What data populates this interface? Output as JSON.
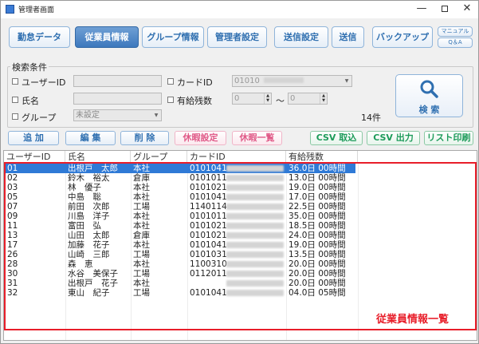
{
  "window": {
    "title": "管理者画面",
    "minimize": "—",
    "close": "✕"
  },
  "tabs": [
    "勤怠データ",
    "従業員情報",
    "グループ情報",
    "管理者設定",
    "送信設定",
    "送信",
    "バックアップ"
  ],
  "help_links": [
    "マニュアル",
    "Q＆A"
  ],
  "search": {
    "title": "検索条件",
    "user_id_label": "ユーザーID",
    "name_label": "氏名",
    "group_label": "グループ",
    "group_value": "未設定",
    "card_id_label": "カードID",
    "card_id_value": "01010",
    "paid_leave_label": "有給残数",
    "range_from": "0",
    "range_sep": "～",
    "range_to": "0",
    "button": "検 索",
    "search_icon": "magnifier-icon",
    "count": "14件"
  },
  "actions": {
    "add": "追 加",
    "edit": "編 集",
    "delete": "削 除",
    "holiday_setting": "休暇設定",
    "holiday_list": "休暇一覧",
    "csv_import": "CSV 取込",
    "csv_export": "CSV 出力",
    "list_print": "リスト印刷"
  },
  "table": {
    "columns": [
      "ユーザーID",
      "氏名",
      "グループ",
      "カードID",
      "有給残数"
    ],
    "rows": [
      {
        "id": "01",
        "name": "出根戸　太郎",
        "group": "本社",
        "card": "0101041",
        "leave": "36.0日 00時間",
        "selected": true
      },
      {
        "id": "02",
        "name": "鈴木　裕太",
        "group": "倉庫",
        "card": "0101011",
        "leave": "13.0日 00時間"
      },
      {
        "id": "03",
        "name": "林　優子",
        "group": "本社",
        "card": "0101021",
        "leave": "19.0日 00時間"
      },
      {
        "id": "05",
        "name": "中島　聡",
        "group": "本社",
        "card": "0101041",
        "leave": "17.0日 00時間"
      },
      {
        "id": "07",
        "name": "前田　次郎",
        "group": "工場",
        "card": "1140114",
        "leave": "22.5日 00時間"
      },
      {
        "id": "09",
        "name": "川島　洋子",
        "group": "本社",
        "card": "0101011",
        "leave": "35.0日 00時間"
      },
      {
        "id": "11",
        "name": "富田　弘",
        "group": "本社",
        "card": "0101021",
        "leave": "18.5日 00時間"
      },
      {
        "id": "13",
        "name": "山田　太郎",
        "group": "倉庫",
        "card": "0101021",
        "leave": "24.0日 00時間"
      },
      {
        "id": "17",
        "name": "加藤　花子",
        "group": "本社",
        "card": "0101041",
        "leave": "19.0日 00時間"
      },
      {
        "id": "26",
        "name": "山崎　三郎",
        "group": "工場",
        "card": "0101031",
        "leave": "13.5日 00時間"
      },
      {
        "id": "28",
        "name": "森　恵",
        "group": "本社",
        "card": "1100310",
        "leave": "20.0日 00時間"
      },
      {
        "id": "30",
        "name": "水谷　美保子",
        "group": "工場",
        "card": "0112011",
        "leave": "20.0日 00時間"
      },
      {
        "id": "31",
        "name": "出根戸　花子",
        "group": "本社",
        "card": "",
        "leave": "20.0日 00時間"
      },
      {
        "id": "32",
        "name": "東山　紀子",
        "group": "工場",
        "card": "0101041",
        "leave": "04.0日 05時間"
      }
    ]
  },
  "annotation": "従業員情報一覧",
  "colors": {
    "accent": "#2f6fb0",
    "active_tab": "#3d78bd",
    "pink": "#e05a88",
    "green": "#1d9b5a",
    "highlight": "#e81e2a",
    "selected_row": "#2f7ad6"
  }
}
